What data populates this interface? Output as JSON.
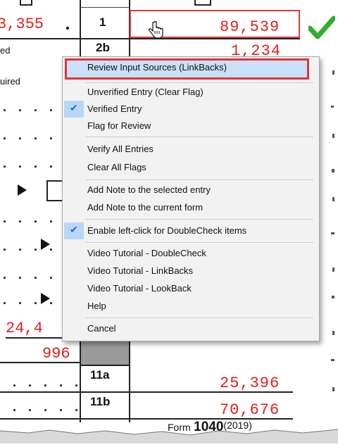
{
  "form": {
    "left_amount_top": "3,355",
    "side_labels": [
      "ed",
      "uired"
    ],
    "lines": [
      {
        "no": "1",
        "amount": "89,539"
      },
      {
        "no": "2b",
        "amount": "1,234"
      },
      {
        "no": "11a",
        "amount": "25,396"
      },
      {
        "no": "11b",
        "amount": "70,676"
      }
    ],
    "left_amount_mid": "24,4",
    "left_amount_996": "996",
    "footer_form": "Form",
    "footer_number": "1040",
    "footer_year": "(2019)"
  },
  "menu": {
    "items": [
      {
        "label": "Review Input Sources (LinkBacks)"
      },
      {
        "label": "Unverified Entry (Clear Flag)"
      },
      {
        "label": "Verified Entry"
      },
      {
        "label": "Flag for Review"
      },
      {
        "label": "Verify All Entries"
      },
      {
        "label": "Clear All Flags"
      },
      {
        "label": "Add Note to the selected entry"
      },
      {
        "label": "Add Note to the current form"
      },
      {
        "label": "Enable left-click for DoubleCheck items"
      },
      {
        "label": "Video Tutorial - DoubleCheck"
      },
      {
        "label": "Video Tutorial - LinkBacks"
      },
      {
        "label": "Video Tutorial - LookBack"
      },
      {
        "label": "Help"
      },
      {
        "label": "Cancel"
      }
    ]
  },
  "colors": {
    "accent_red": "#e0201c",
    "check_green": "#2fae2f",
    "menu_highlight": "#c9e0f7"
  },
  "icons": [
    "hand-cursor-icon",
    "green-checkmark-icon",
    "checkmark-icon"
  ]
}
